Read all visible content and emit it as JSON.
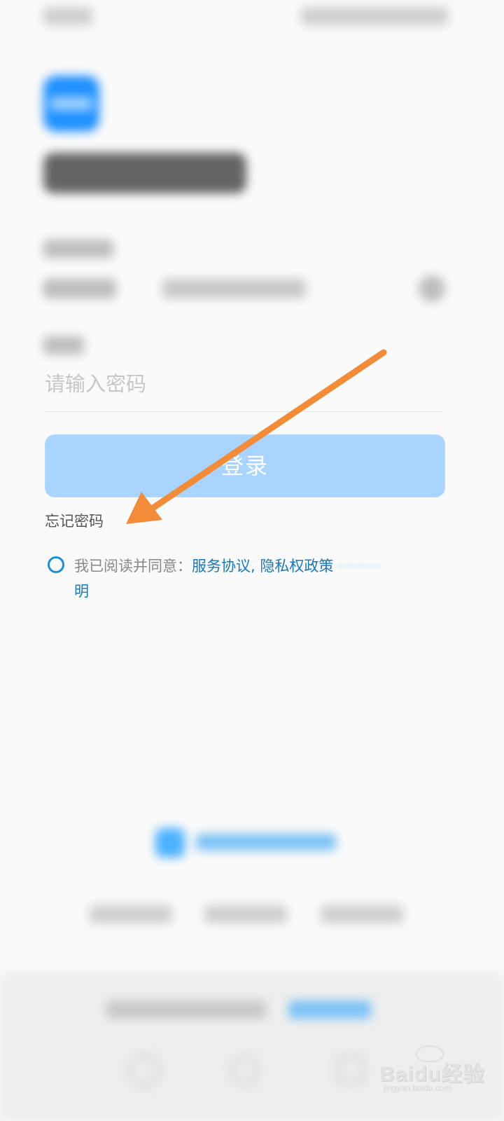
{
  "login": {
    "password_placeholder": "请输入密码",
    "login_button": "登录",
    "forgot_password": "忘记密码"
  },
  "agreement": {
    "prefix": "我已阅读并同意：",
    "service_agreement": "服务协议",
    "separator": ",",
    "privacy_policy": "隐私权政策",
    "trailing_char": "明"
  },
  "watermark": {
    "brand": "Bai",
    "brand_mid": "du",
    "brand_cn": "经验",
    "url": "jingyan.baidu.com"
  },
  "colors": {
    "accent": "#1a8fd8",
    "link": "#1a78b8",
    "login_button": "#a9d4ff",
    "annotation_arrow": "#f28c38"
  },
  "icons": {
    "agree_checkbox": "radio-circle-icon",
    "clear_icon": "clear-icon",
    "annotation": "arrow-icon"
  }
}
